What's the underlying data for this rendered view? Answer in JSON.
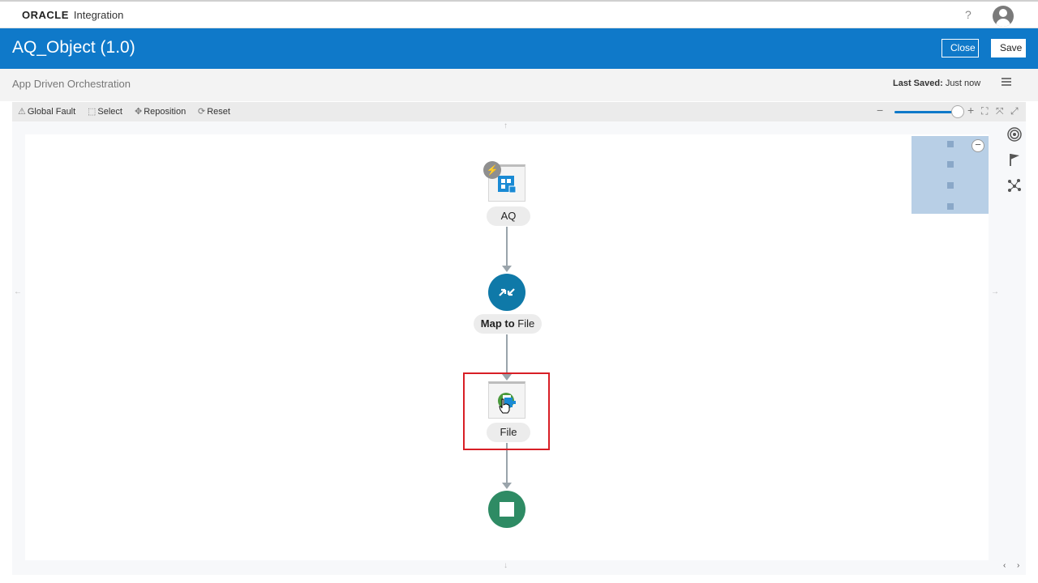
{
  "app": {
    "logo": "ORACLE",
    "product": "Integration",
    "help": "?"
  },
  "header": {
    "title": "AQ_Object (1.0)",
    "close_label": "Close",
    "save_label": "Save"
  },
  "subheader": {
    "type": "App Driven Orchestration",
    "last_saved_label": "Last Saved:",
    "last_saved_value": "Just now"
  },
  "toolbar": {
    "global_fault": "Global Fault",
    "select": "Select",
    "reposition": "Reposition",
    "reset": "Reset",
    "zoom_minus": "−",
    "zoom_plus": "+",
    "zoom_level_pct": 100
  },
  "flow": {
    "trigger_label": "AQ",
    "map_label_bold": "Map to",
    "map_label_rest": "File",
    "invoke_label": "File"
  },
  "colors": {
    "header_blue": "#0f79c9",
    "map_node": "#0f79a8",
    "end_node": "#2e8b64",
    "highlight": "#d81f26"
  },
  "icons": [
    "warning-icon",
    "select-icon",
    "reposition-icon",
    "reset-icon",
    "fit-icon",
    "target-icon",
    "flag-icon",
    "graph-icon",
    "menu-icon",
    "user-icon"
  ]
}
